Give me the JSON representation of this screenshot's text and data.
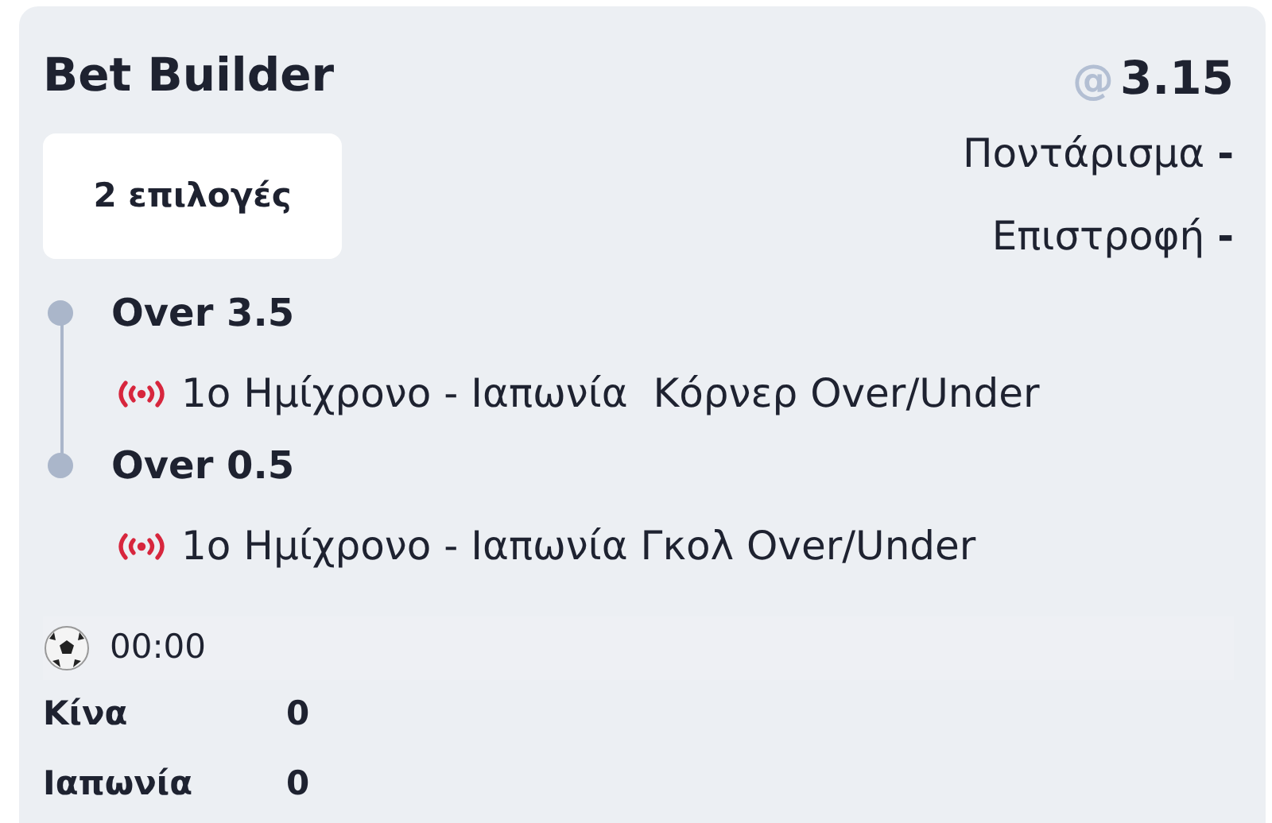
{
  "title": "Bet Builder",
  "selections_count": "2 επιλογές",
  "odds": {
    "symbol": "@",
    "value": "3.15"
  },
  "stake": {
    "label": "Ποντάρισμα",
    "value": "-"
  },
  "returns": {
    "label": "Επιστροφή",
    "value": "-"
  },
  "selections": [
    {
      "name": "Over 3.5",
      "live": true,
      "market": "1ο Ημίχρονο - Ιαπωνία  Κόρνερ Over/Under"
    },
    {
      "name": "Over 0.5",
      "live": true,
      "market": "1ο Ημίχρονο - Ιαπωνία Γκολ Over/Under"
    }
  ],
  "match": {
    "time": "00:00",
    "teams": [
      {
        "name": "Κίνα",
        "score": "0"
      },
      {
        "name": "Ιαπωνία",
        "score": "0"
      }
    ]
  }
}
